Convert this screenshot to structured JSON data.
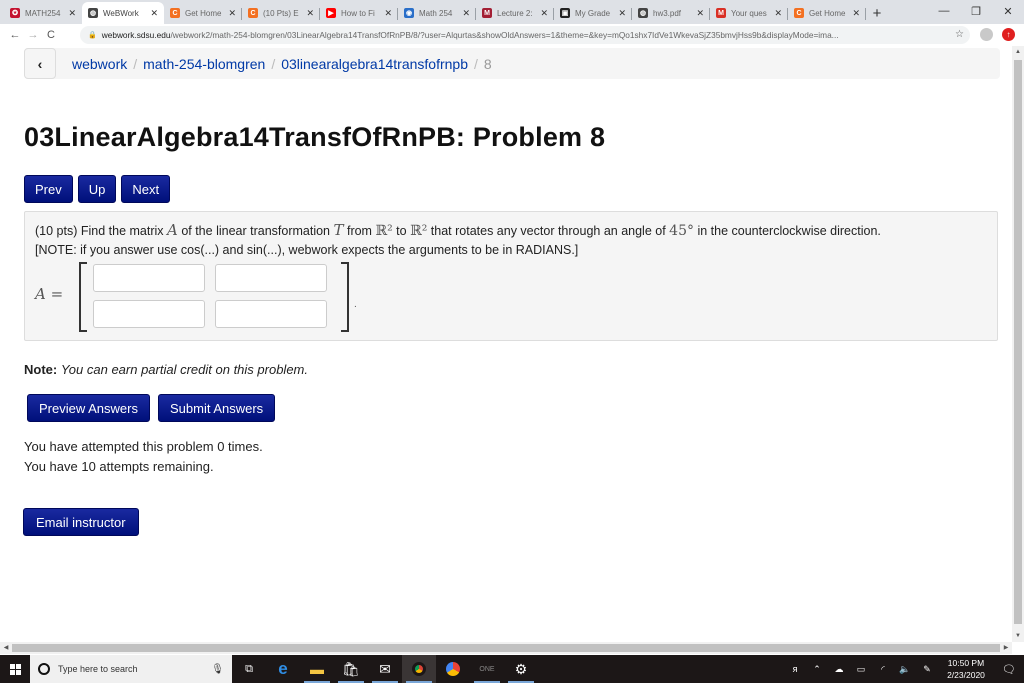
{
  "browser": {
    "tabs": [
      {
        "title": "MATH254",
        "icon": "sdsu-icon",
        "color": "#c41230",
        "glyph": "✪"
      },
      {
        "title": "WeBWork",
        "icon": "globe-icon",
        "color": "#444444",
        "glyph": "◍",
        "active": true
      },
      {
        "title": "Get Home",
        "icon": "chegg-icon",
        "color": "#f37021",
        "glyph": "C"
      },
      {
        "title": "(10 Pts) E",
        "icon": "chegg-icon",
        "color": "#f37021",
        "glyph": "C"
      },
      {
        "title": "How to Fi",
        "icon": "youtube-icon",
        "color": "#ff0000",
        "glyph": "▶"
      },
      {
        "title": "Math 254",
        "icon": "math-icon",
        "color": "#2a6fc9",
        "glyph": "◉"
      },
      {
        "title": "Lecture 2:",
        "icon": "mit-icon",
        "color": "#a31f34",
        "glyph": "M"
      },
      {
        "title": "My Grade",
        "icon": "grades-icon",
        "color": "#222222",
        "glyph": "▣"
      },
      {
        "title": "hw3.pdf",
        "icon": "globe-icon",
        "color": "#444444",
        "glyph": "◍"
      },
      {
        "title": "Your ques",
        "icon": "gmail-icon",
        "color": "#d93025",
        "glyph": "M"
      },
      {
        "title": "Get Home",
        "icon": "chegg-icon",
        "color": "#f37021",
        "glyph": "C"
      }
    ],
    "close_glyph": "✕",
    "new_tab_glyph": "+",
    "url_host": "webwork.sdsu.edu",
    "url_rest": "/webwork2/math-254-blomgren/03LinearAlgebra14TransfOfRnPB/8/?user=Alqurtas&showOldAnswers=1&theme=&key=mQo1shx7IdVe1WkevaSjZ35bmvjHss9b&displayMode=ima..."
  },
  "breadcrumb": {
    "items": [
      "webwork",
      "math-254-blomgren",
      "03linearalgebra14transfofrnpb"
    ],
    "current": "8",
    "separator": "/"
  },
  "page_title": "03LinearAlgebra14TransfOfRnPB: Problem 8",
  "nav": {
    "prev": "Prev",
    "up": "Up",
    "next": "Next"
  },
  "problem": {
    "t1": "(10 pts) Find the matrix ",
    "var_A": "A",
    "t2": " of the linear transformation ",
    "var_T": "T",
    "t3": " from ",
    "space1": "ℝ²",
    "t4": " to ",
    "space2": "ℝ²",
    "t5": " that rotates any vector through an angle of ",
    "angle": "45°",
    "t6": " in the counterclockwise direction.",
    "note_line": "[NOTE: if you answer use cos(...) and sin(...), webwork expects the arguments to be in RADIANS.]",
    "matrix_label": "A",
    "equals": "=",
    "answers": [
      "",
      "",
      "",
      ""
    ]
  },
  "note": {
    "label": "Note:",
    "text": "You can earn partial credit on this problem."
  },
  "actions": {
    "preview": "Preview Answers",
    "submit": "Submit Answers"
  },
  "attempts": {
    "line1": "You have attempted this problem 0 times.",
    "line2": "You have 10 attempts remaining."
  },
  "email_button": "Email instructor",
  "taskbar": {
    "search_placeholder": "Type here to search",
    "time": "10:50 PM",
    "date": "2/23/2020"
  }
}
